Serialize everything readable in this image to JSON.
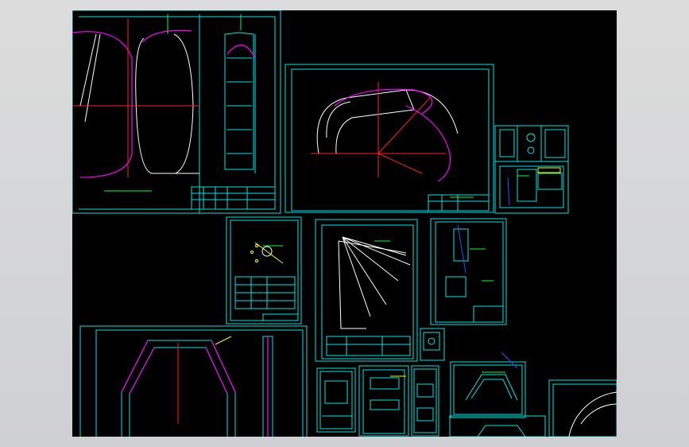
{
  "app": {
    "background_color": "#d4d0c8",
    "canvas_color": "#000000"
  },
  "colors": {
    "frame": "#00e5e5",
    "geometry_white": "#ffffff",
    "geometry_magenta": "#ff00ff",
    "axis_red": "#ff2020",
    "annotation_green": "#00ff40",
    "annotation_yellow": "#ffff00",
    "hatch_blue": "#3050ff"
  },
  "drawing": {
    "sheets": [
      {
        "id": "sheet-top-left",
        "description_icon": "elevation-plan-sheet"
      },
      {
        "id": "sheet-top-middle",
        "description_icon": "curved-duct-sheet"
      },
      {
        "id": "sheet-top-right",
        "description_icon": "detail-sheet-small"
      },
      {
        "id": "sheet-middle-left",
        "description_icon": "detail-sheet"
      },
      {
        "id": "sheet-middle-center",
        "description_icon": "fan-layout-sheet"
      },
      {
        "id": "sheet-middle-right",
        "description_icon": "section-detail-sheet"
      },
      {
        "id": "sheet-bottom-left",
        "description_icon": "hexagon-frame-sheet"
      },
      {
        "id": "sheet-bottom-small-1",
        "description_icon": "part-sheet"
      },
      {
        "id": "sheet-bottom-small-2",
        "description_icon": "part-sheet"
      },
      {
        "id": "sheet-bottom-small-3",
        "description_icon": "part-sheet"
      },
      {
        "id": "sheet-bottom-small-4",
        "description_icon": "part-sheet"
      },
      {
        "id": "sheet-bottom-right-1",
        "description_icon": "trapezoid-sheet"
      },
      {
        "id": "sheet-bottom-right-2",
        "description_icon": "circular-flange-sheet"
      }
    ]
  }
}
